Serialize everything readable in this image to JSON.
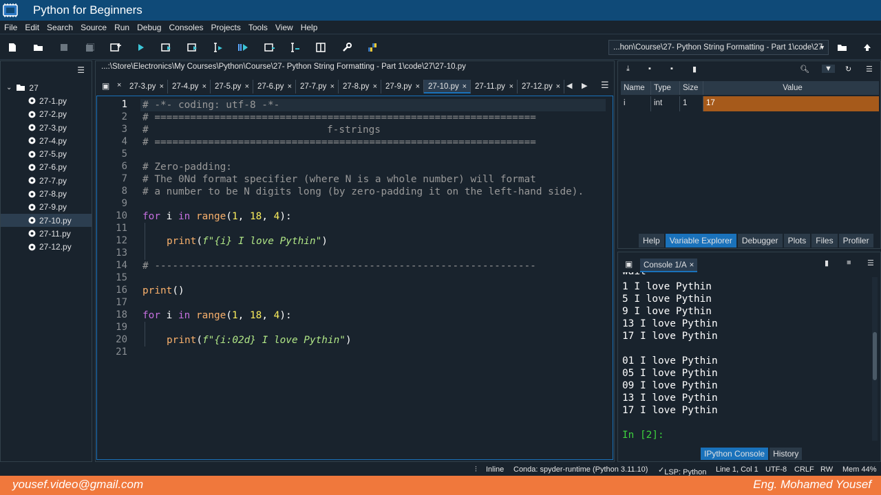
{
  "window": {
    "title": "Python for Beginners"
  },
  "menu": [
    "File",
    "Edit",
    "Search",
    "Source",
    "Run",
    "Debug",
    "Consoles",
    "Projects",
    "Tools",
    "View",
    "Help"
  ],
  "toolbar": {
    "working_dir": "...hon\\Course\\27- Python  String Formatting - Part 1\\code\\27"
  },
  "explorer": {
    "folder": "27",
    "files": [
      "27-1.py",
      "27-2.py",
      "27-3.py",
      "27-4.py",
      "27-5.py",
      "27-6.py",
      "27-7.py",
      "27-8.py",
      "27-9.py",
      "27-10.py",
      "27-11.py",
      "27-12.py"
    ],
    "selected": "27-10.py"
  },
  "editor": {
    "path": "...:\\Store\\Electronics\\My Courses\\Python\\Course\\27- Python  String Formatting - Part 1\\code\\27\\27-10.py",
    "tabs": [
      "27-3.py",
      "27-4.py",
      "27-5.py",
      "27-6.py",
      "27-7.py",
      "27-8.py",
      "27-9.py",
      "27-10.py",
      "27-11.py",
      "27-12.py"
    ],
    "active_tab": "27-10.py",
    "line_numbers": [
      "1",
      "2",
      "3",
      "4",
      "5",
      "6",
      "7",
      "8",
      "9",
      "10",
      "11",
      "12",
      "13",
      "14",
      "15",
      "16",
      "17",
      "18",
      "19",
      "20",
      "21"
    ],
    "lines": {
      "l1": "# -*- coding: utf-8 -*-",
      "l2": "# ================================================================",
      "l3_hash": "#",
      "l3_title": "f-strings",
      "l4": "# ================================================================",
      "l6": "# Zero-padding:",
      "l7": "# The 0Nd format specifier (where N is a whole number) will format",
      "l8": "# a number to be N digits long (by zero-padding it on the left-hand side).",
      "l14": "# ----------------------------------------------------------------",
      "kw_for": "for",
      "var_i": " i ",
      "kw_in": "in",
      "fn_range": "range",
      "open_paren": "(",
      "n1": "1",
      "comma1": ", ",
      "n18": "18",
      "comma2": ", ",
      "n4": "4",
      "close_colon": "):",
      "fn_print": "print",
      "str12": "f\"{i} I love Pythin\"",
      "str20": "f\"{i:02d} I love Pythin\"",
      "close_paren": ")",
      "print_empty": "()"
    }
  },
  "variables": {
    "headers": [
      "Name",
      "Type",
      "Size",
      "Value"
    ],
    "rows": [
      {
        "name": "i",
        "type": "int",
        "size": "1",
        "value": "17"
      }
    ]
  },
  "panel_tabs": [
    "Help",
    "Variable Explorer",
    "Debugger",
    "Plots",
    "Files",
    "Profiler"
  ],
  "console": {
    "tab": "Console 1/A",
    "partial": "wait",
    "output": [
      "1 I love Pythin",
      "5 I love Pythin",
      "9 I love Pythin",
      "13 I love Pythin",
      "17 I love Pythin",
      "",
      "01 I love Pythin",
      "05 I love Pythin",
      "09 I love Pythin",
      "13 I love Pythin",
      "17 I love Pythin"
    ],
    "prompt": "In [2]:",
    "tabs": [
      "IPython Console",
      "History"
    ]
  },
  "status": {
    "inline": "Inline",
    "conda": "Conda: spyder-runtime (Python 3.11.10)",
    "lsp": "LSP: Python",
    "position": "Line 1, Col 1",
    "encoding": "UTF-8",
    "eol": "CRLF",
    "mode": "RW",
    "mem": "Mem 44%"
  },
  "footer": {
    "email": "yousef.video@gmail.com",
    "author": "Eng. Mohamed Yousef"
  }
}
